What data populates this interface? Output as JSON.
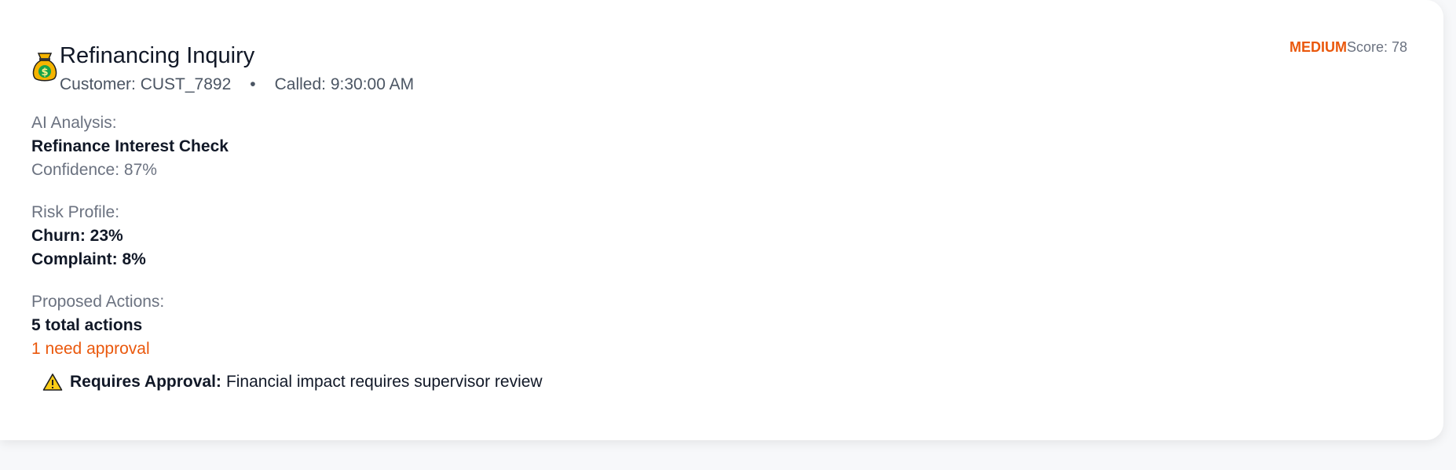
{
  "card": {
    "title": "Refinancing Inquiry",
    "icon": "money-bag-icon",
    "customer": "Customer: CUST_7892",
    "separator": "•",
    "called": "Called: 9:30:00 AM",
    "priority": "MEDIUM",
    "score": "Score: 78"
  },
  "analysis": {
    "heading": "AI Analysis:",
    "intent": "Refinance Interest Check",
    "confidence": "Confidence: 87%"
  },
  "risk": {
    "heading": "Risk Profile:",
    "churn": "Churn: 23%",
    "complaint": "Complaint: 8%"
  },
  "actions": {
    "heading": "Proposed Actions:",
    "total": "5 total actions",
    "approval_count": "1 need approval"
  },
  "approval_notice": {
    "icon": "warning-icon",
    "label": "Requires Approval:",
    "reason": "Financial impact requires supervisor review"
  },
  "colors": {
    "accent_orange": "#ea580c",
    "text_dark": "#111827",
    "text_muted": "#6b7280",
    "background": "#f7f8fa",
    "card": "#ffffff"
  }
}
